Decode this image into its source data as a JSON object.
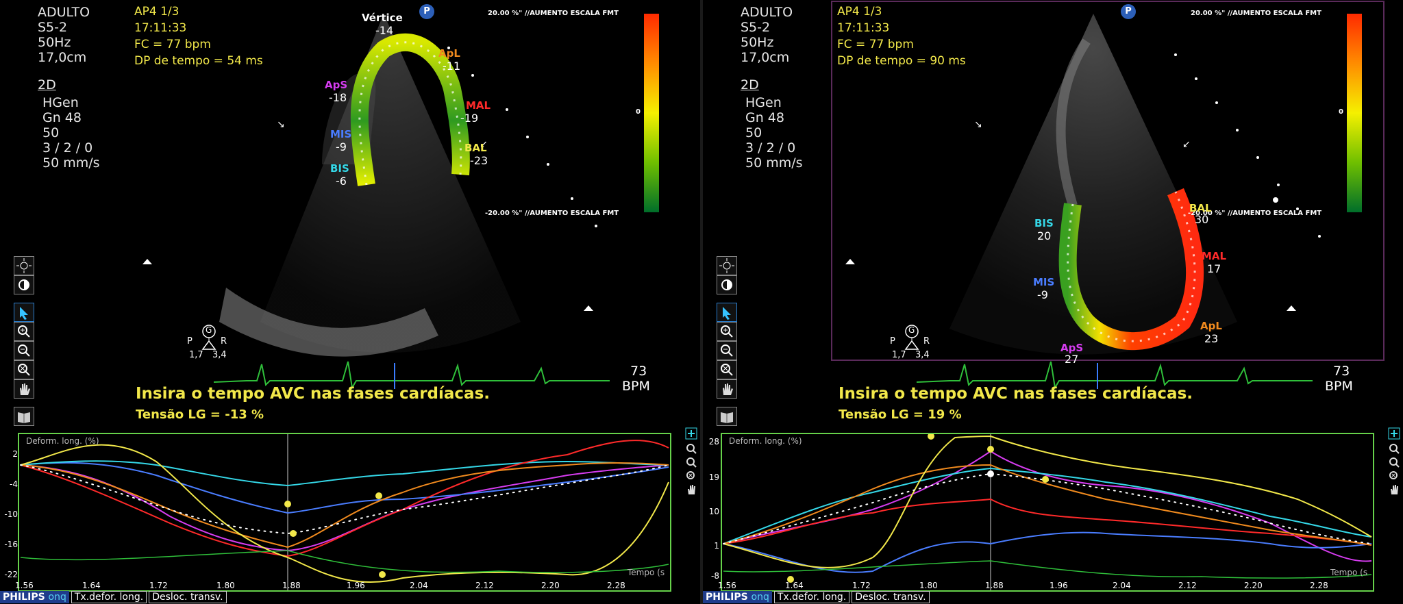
{
  "left": {
    "info": [
      "ADULTO",
      "S5-2",
      "50Hz",
      "17,0cm"
    ],
    "mode": "2D",
    "params": [
      "HGen",
      "Gn 48",
      "50",
      "3 / 2 / 0",
      "50 mm/s"
    ],
    "view": "AP4  1/3",
    "time": "17:11:33",
    "hr": "FC = 77 bpm",
    "dp": "DP de tempo = 54 ms",
    "badge": "P",
    "scale_top": "20.00 %\" //AUMENTO ESCALA FMT",
    "scale_mid": "0",
    "scale_bot": "-20.00 %\" //AUMENTO ESCALA FMT",
    "segments": [
      {
        "name": "Vértice",
        "value": "-14"
      },
      {
        "name": "ApL",
        "value": "-11"
      },
      {
        "name": "ApS",
        "value": "-18"
      },
      {
        "name": "MAL",
        "value": "-19"
      },
      {
        "name": "MIS",
        "value": "-9"
      },
      {
        "name": "BAL",
        "value": "-23"
      },
      {
        "name": "BIS",
        "value": "-6"
      }
    ],
    "probe": {
      "letter": "G",
      "p": "P",
      "r": "R",
      "v1": "1,7",
      "v2": "3,4"
    },
    "bpm_value": "73",
    "bpm_unit": "BPM",
    "instruction": "Insira o tempo AVC nas fases cardíacas.",
    "strain": "Tensão LG = -13 %",
    "graph": {
      "title": "Deform. long. (%)",
      "yticks": [
        "2",
        "-4",
        "-10",
        "-16",
        "-22"
      ],
      "xticks": [
        "1.56",
        "1.64",
        "1.72",
        "1.80",
        "1.88",
        "1.96",
        "2.04",
        "2.12",
        "2.20",
        "2.28"
      ],
      "xunit": "Tempo (s"
    }
  },
  "right": {
    "info": [
      "ADULTO",
      "S5-2",
      "50Hz",
      "17,0cm"
    ],
    "mode": "2D",
    "params": [
      "HGen",
      "Gn 48",
      "50",
      "3 / 2 / 0",
      "50 mm/s"
    ],
    "view": "AP4  1/3",
    "time": "17:11:33",
    "hr": "FC = 77 bpm",
    "dp": "DP de tempo = 90 ms",
    "badge": "P",
    "scale_top": "20.00 %\" //AUMENTO ESCALA FMT",
    "scale_mid": "0",
    "scale_bot": "-20.00 %\" //AUMENTO ESCALA FMT",
    "segments": [
      {
        "name": "BAL",
        "value": "30"
      },
      {
        "name": "BIS",
        "value": "20"
      },
      {
        "name": "MAL",
        "value": "17"
      },
      {
        "name": "MIS",
        "value": "-9"
      },
      {
        "name": "ApL",
        "value": "23"
      },
      {
        "name": "ApS",
        "value": "27"
      }
    ],
    "probe": {
      "letter": "G",
      "p": "P",
      "r": "R",
      "v1": "1,7",
      "v2": "3,4"
    },
    "bpm_value": "73",
    "bpm_unit": "BPM",
    "instruction": "Insira o tempo AVC nas fases cardíacas.",
    "strain": "Tensão LG = 19 %",
    "graph": {
      "title": "Deform. long. (%)",
      "yticks": [
        "28",
        "19",
        "10",
        "1",
        "-8"
      ],
      "xticks": [
        "1.56",
        "1.64",
        "1.72",
        "1.80",
        "1.88",
        "1.96",
        "2.04",
        "2.12",
        "2.20",
        "2.28"
      ],
      "xunit": "Tempo (s"
    }
  },
  "footer": {
    "brand": "PHILIPS",
    "brand_suffix": "onq",
    "tab1": "Tx.defor. long.",
    "tab2": "Desloc. transv."
  },
  "colors": {
    "ApS": "#d63cf0",
    "MIS": "#4a7dff",
    "BIS": "#35d8e8",
    "ApL": "#f08a1e",
    "MAL": "#ff2a2a",
    "BAL": "#f2e84a",
    "accent": "#f2e84a",
    "graph_border": "#66d24a"
  }
}
